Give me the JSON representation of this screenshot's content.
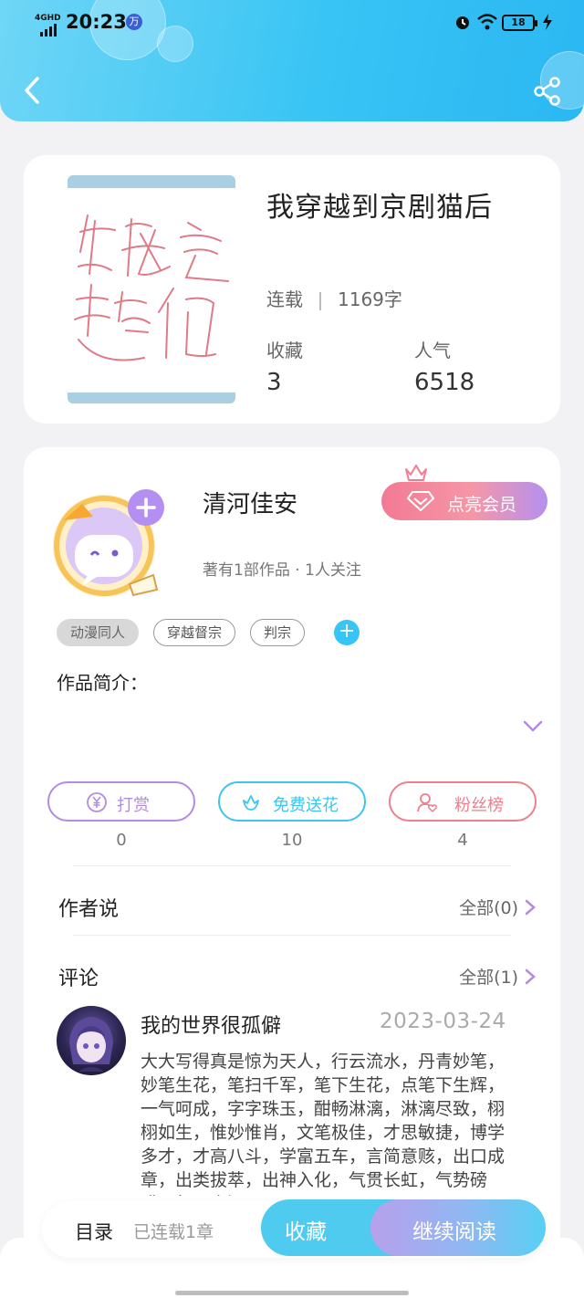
{
  "status_bar": {
    "network": "4GHD",
    "time": "20:23",
    "app_badge": "万",
    "battery": "18"
  },
  "header": {
    "back_icon": "chevron-left-icon",
    "share_icon": "share-icon"
  },
  "book": {
    "title": "我穿越到京剧猫后",
    "status": "连载",
    "word_count": "1169字",
    "favorites_label": "收藏",
    "favorites_value": "3",
    "popularity_label": "人气",
    "popularity_value": "6518"
  },
  "author": {
    "name": "清河佳安",
    "meta": "著有1部作品 · 1人关注",
    "vip_button": "点亮会员"
  },
  "tags": [
    "动漫同人",
    "穿越督宗",
    "判宗"
  ],
  "intro_label": "作品简介：",
  "actions": [
    {
      "label": "打赏",
      "count": "0",
      "color": "#b58be0",
      "icon": "yen-icon"
    },
    {
      "label": "免费送花",
      "count": "10",
      "color": "#3cc5ee",
      "icon": "flower-icon"
    },
    {
      "label": "粉丝榜",
      "count": "4",
      "color": "#ee7f8c",
      "icon": "fan-user-icon"
    }
  ],
  "author_says": {
    "title": "作者说",
    "more": "全部(0)"
  },
  "comments": {
    "title": "评论",
    "more": "全部(1)",
    "items": [
      {
        "user": "我的世界很孤僻",
        "date": "2023-03-24",
        "text": "大大写得真是惊为天人，行云流水，丹青妙笔，妙笔生花，笔扫千军，笔下生花，点笔下生辉，一气呵成，字字珠玉，酣畅淋漓，淋漓尽致，栩栩如生，惟妙惟肖，文笔极佳，才思敏捷，博学多才，才高八斗，学富五车，言简意赅，出口成章，出类拔萃，出神入化，气贯长虹，气势磅礴，气吞山河"
      }
    ]
  },
  "bottom_bar": {
    "catalog": "目录",
    "serial": "已连载1章",
    "favorite_button": "收藏",
    "read_button": "继续阅读"
  },
  "colors": {
    "header_gradient_start": "#6fd6f6",
    "header_gradient_end": "#2bb7f2",
    "accent_blue": "#38c4f4",
    "vip_pink": "#f27a92",
    "purple": "#b58be0"
  }
}
